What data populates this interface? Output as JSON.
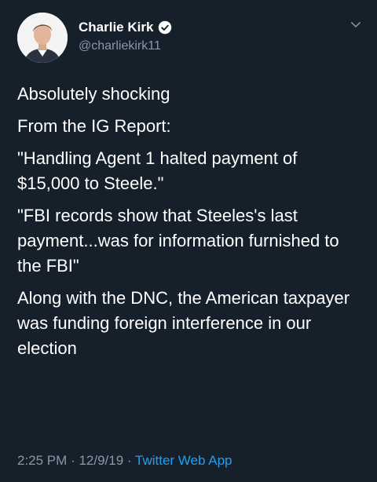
{
  "tweet": {
    "author": {
      "display_name": "Charlie Kirk",
      "handle": "@charliekirk11",
      "verified": true
    },
    "paragraphs": [
      "Absolutely shocking",
      "From the IG Report:",
      "\"Handling Agent 1 halted payment of $15,000 to Steele.\"",
      "\"FBI records show that Steeles's last payment...was for information furnished to the FBI\"",
      "Along with the DNC, the American taxpayer was funding foreign interference in our election"
    ],
    "footer": {
      "time": "2:25 PM",
      "separator": "·",
      "date": "12/9/19",
      "source": "Twitter Web App"
    }
  },
  "colors": {
    "background": "#15202b",
    "text": "#ffffff",
    "secondary_text": "#8899a6",
    "accent": "#1da1f2"
  },
  "icons": {
    "verified": "verified-badge-icon",
    "menu": "chevron-down-icon"
  }
}
